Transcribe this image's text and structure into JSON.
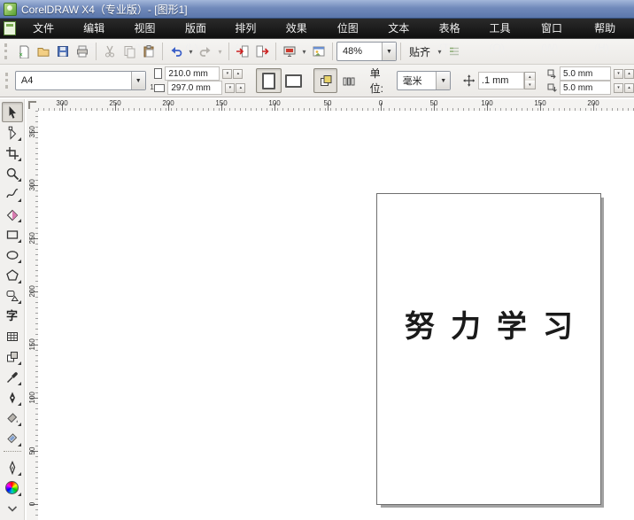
{
  "title_bar": {
    "title": "CorelDRAW X4（专业版）- [图形1]"
  },
  "menu_bar": {
    "items": [
      {
        "id": "file",
        "label": "文件(F)"
      },
      {
        "id": "edit",
        "label": "编辑(E)"
      },
      {
        "id": "view",
        "label": "视图(V)"
      },
      {
        "id": "layout",
        "label": "版面(L)"
      },
      {
        "id": "arrange",
        "label": "排列(A)"
      },
      {
        "id": "effects",
        "label": "效果(C)"
      },
      {
        "id": "bitmaps",
        "label": "位图(B)"
      },
      {
        "id": "text",
        "label": "文本(X)"
      },
      {
        "id": "table",
        "label": "表格(T)"
      },
      {
        "id": "tools",
        "label": "工具(O)"
      },
      {
        "id": "window",
        "label": "窗口(W)"
      },
      {
        "id": "help",
        "label": "帮助(H)"
      }
    ]
  },
  "toolbar": {
    "zoom_level": "48%",
    "snap_label": "贴齐",
    "icons": [
      "new",
      "open",
      "save",
      "print",
      "cut",
      "copy",
      "paste",
      "undo",
      "redo",
      "import",
      "export",
      "application-launcher",
      "welcome-screen",
      "options"
    ]
  },
  "property_bar": {
    "paper_type": "A4",
    "paper_width": "210.0 mm",
    "paper_height": "297.0 mm",
    "units_label": "单位:",
    "units_value": "毫米",
    "nudge_offset": ".1 mm",
    "duplicate_x": "5.0 mm",
    "duplicate_y": "5.0 mm"
  },
  "rulers": {
    "horizontal_labels": [
      "300",
      "250",
      "200",
      "150",
      "100",
      "50",
      "0",
      "50",
      "100",
      "150",
      "200"
    ],
    "vertical_labels": [
      "350",
      "300",
      "250",
      "200",
      "150",
      "100",
      "50",
      "0"
    ]
  },
  "toolbox": {
    "tools": [
      {
        "name": "pick-tool",
        "icon": "pick",
        "selected": true
      },
      {
        "name": "shape-tool",
        "icon": "shape",
        "flyout": true
      },
      {
        "name": "crop-tool",
        "icon": "crop",
        "flyout": true
      },
      {
        "name": "zoom-tool",
        "icon": "zoom",
        "flyout": true
      },
      {
        "name": "freehand-tool",
        "icon": "freehand",
        "flyout": true
      },
      {
        "name": "smart-fill-tool",
        "icon": "smartfill",
        "flyout": true
      },
      {
        "name": "rectangle-tool",
        "icon": "rectangle",
        "flyout": true
      },
      {
        "name": "ellipse-tool",
        "icon": "ellipse",
        "flyout": true
      },
      {
        "name": "polygon-tool",
        "icon": "polygon",
        "flyout": true
      },
      {
        "name": "basic-shapes-tool",
        "icon": "basicshapes",
        "flyout": true
      },
      {
        "name": "text-tool",
        "icon": "text",
        "glyph": "字"
      },
      {
        "name": "table-tool",
        "icon": "table"
      },
      {
        "name": "interactive-blend-tool",
        "icon": "blend",
        "flyout": true
      },
      {
        "name": "eyedropper-tool",
        "icon": "eyedropper",
        "flyout": true
      },
      {
        "name": "outline-pen-tool",
        "icon": "outlinepen",
        "flyout": true
      },
      {
        "name": "fill-tool",
        "icon": "fill",
        "flyout": true
      },
      {
        "name": "interactive-fill-tool",
        "icon": "interactivefill",
        "flyout": true
      },
      {
        "type": "divider"
      },
      {
        "name": "outline-flyout-tool",
        "icon": "pen2",
        "flyout": true
      },
      {
        "name": "fill-color-tool",
        "icon": "colorwheel",
        "flyout": true
      },
      {
        "name": "toolbox-more",
        "icon": "chevron"
      }
    ]
  },
  "canvas": {
    "page_text": "努力学习"
  },
  "colors": {
    "titlebar_blue": "#5b77ab",
    "menubar_black": "#141414",
    "accent_red": "#cc2222",
    "undo_blue": "#3a5fc8"
  }
}
